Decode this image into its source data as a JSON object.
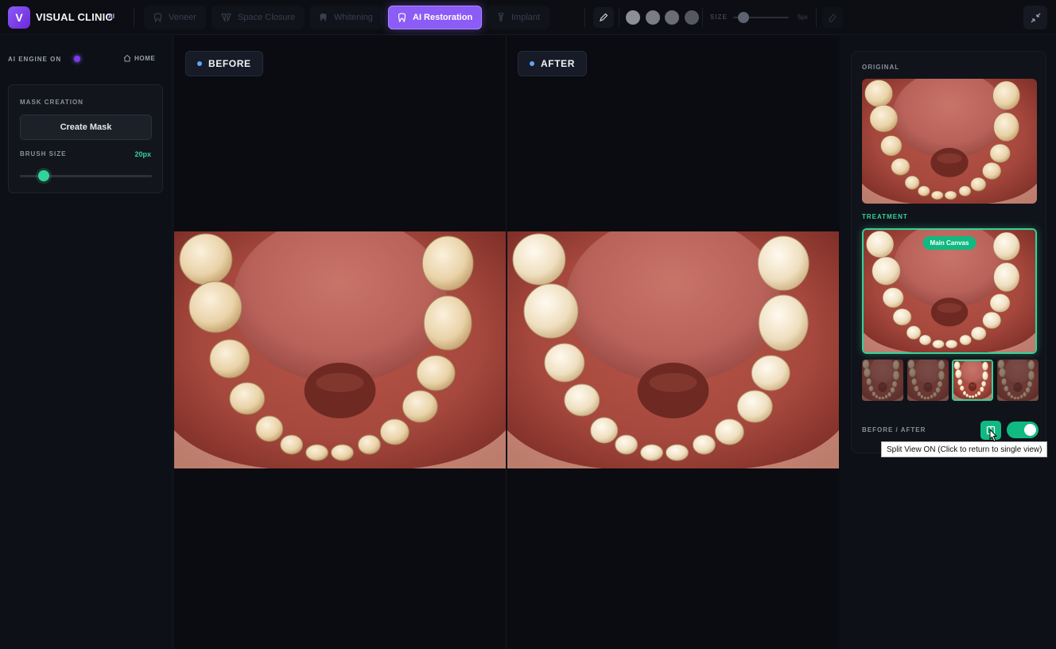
{
  "app": {
    "logo_letter": "V",
    "brand": "VISUAL CLINIC",
    "brand_suffix": "AI",
    "accent": "#8b5cf6",
    "success": "#10b981"
  },
  "tools": [
    {
      "label": "Veneer",
      "icon": "tooth-icon",
      "active": false
    },
    {
      "label": "Space Closure",
      "icon": "teeth-icon",
      "active": false
    },
    {
      "label": "Whitening",
      "icon": "tooth-icon",
      "active": false
    },
    {
      "label": "AI Restoration",
      "icon": "tooth-icon",
      "active": true
    },
    {
      "label": "Implant",
      "icon": "implant-icon",
      "active": false
    }
  ],
  "toolbar": {
    "pencil_icon": "pencil-icon",
    "colors": [
      "#8d8f96",
      "#7a7d84",
      "#6a6d74",
      "#55585f"
    ],
    "size_label": "SIZE",
    "size_value": "5px",
    "size_fraction": 0.18,
    "eraser_icon": "eraser-icon",
    "collapse_icon": "collapse-icon"
  },
  "sidebar": {
    "engine_label": "AI ENGINE ON",
    "home_label": "HOME",
    "mask_title": "MASK CREATION",
    "create_mask_label": "Create Mask",
    "brush_label": "BRUSH SIZE",
    "brush_value": "20px",
    "brush_fraction": 0.18
  },
  "canvas": {
    "before_label": "BEFORE",
    "after_label": "AFTER"
  },
  "panel": {
    "original_label": "ORIGINAL",
    "treatment_label": "TREATMENT",
    "main_canvas_label": "Main Canvas",
    "before_after_label": "BEFORE / AFTER",
    "split_view_on": true,
    "selected_variant": 3,
    "variant_count": 4,
    "tooltip": "Split View ON (Click to return to single view)"
  }
}
